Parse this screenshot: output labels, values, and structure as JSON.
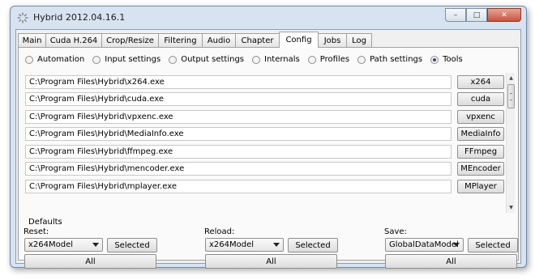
{
  "window": {
    "title": "Hybrid 2012.04.16.1",
    "controls": {
      "minimize": "–",
      "maximize": "□",
      "close": "✕"
    }
  },
  "tabs": [
    {
      "label": "Main"
    },
    {
      "label": "Cuda H.264"
    },
    {
      "label": "Crop/Resize"
    },
    {
      "label": "Filtering"
    },
    {
      "label": "Audio"
    },
    {
      "label": "Chapter"
    },
    {
      "label": "Config",
      "active": true
    },
    {
      "label": "Jobs"
    },
    {
      "label": "Log"
    }
  ],
  "subtabs": [
    {
      "label": "Automation",
      "checked": false
    },
    {
      "label": "Input settings",
      "checked": false
    },
    {
      "label": "Output settings",
      "checked": false
    },
    {
      "label": "Internals",
      "checked": false
    },
    {
      "label": "Profiles",
      "checked": false
    },
    {
      "label": "Path settings",
      "checked": false
    },
    {
      "label": "Tools",
      "checked": true
    }
  ],
  "tools": [
    {
      "path": "C:\\Program Files\\Hybrid\\x264.exe",
      "button": "x264"
    },
    {
      "path": "C:\\Program Files\\Hybrid\\cuda.exe",
      "button": "cuda"
    },
    {
      "path": "C:\\Program Files\\Hybrid\\vpxenc.exe",
      "button": "vpxenc"
    },
    {
      "path": "C:\\Program Files\\Hybrid\\MediaInfo.exe",
      "button": "MediaInfo"
    },
    {
      "path": "C:\\Program Files\\Hybrid\\ffmpeg.exe",
      "button": "FFmpeg"
    },
    {
      "path": "C:\\Program Files\\Hybrid\\mencoder.exe",
      "button": "MEncoder"
    },
    {
      "path": "C:\\Program Files\\Hybrid\\mplayer.exe",
      "button": "MPlayer"
    }
  ],
  "defaults": {
    "label": "Defaults",
    "reset": {
      "label": "Reset:",
      "combo": "x264Model",
      "selected": "Selected",
      "all": "All"
    },
    "reload": {
      "label": "Reload:",
      "combo": "x264Model",
      "selected": "Selected",
      "all": "All"
    },
    "save": {
      "label": "Save:",
      "combo": "GlobalDataModel",
      "selected": "Selected",
      "all": "All"
    }
  }
}
